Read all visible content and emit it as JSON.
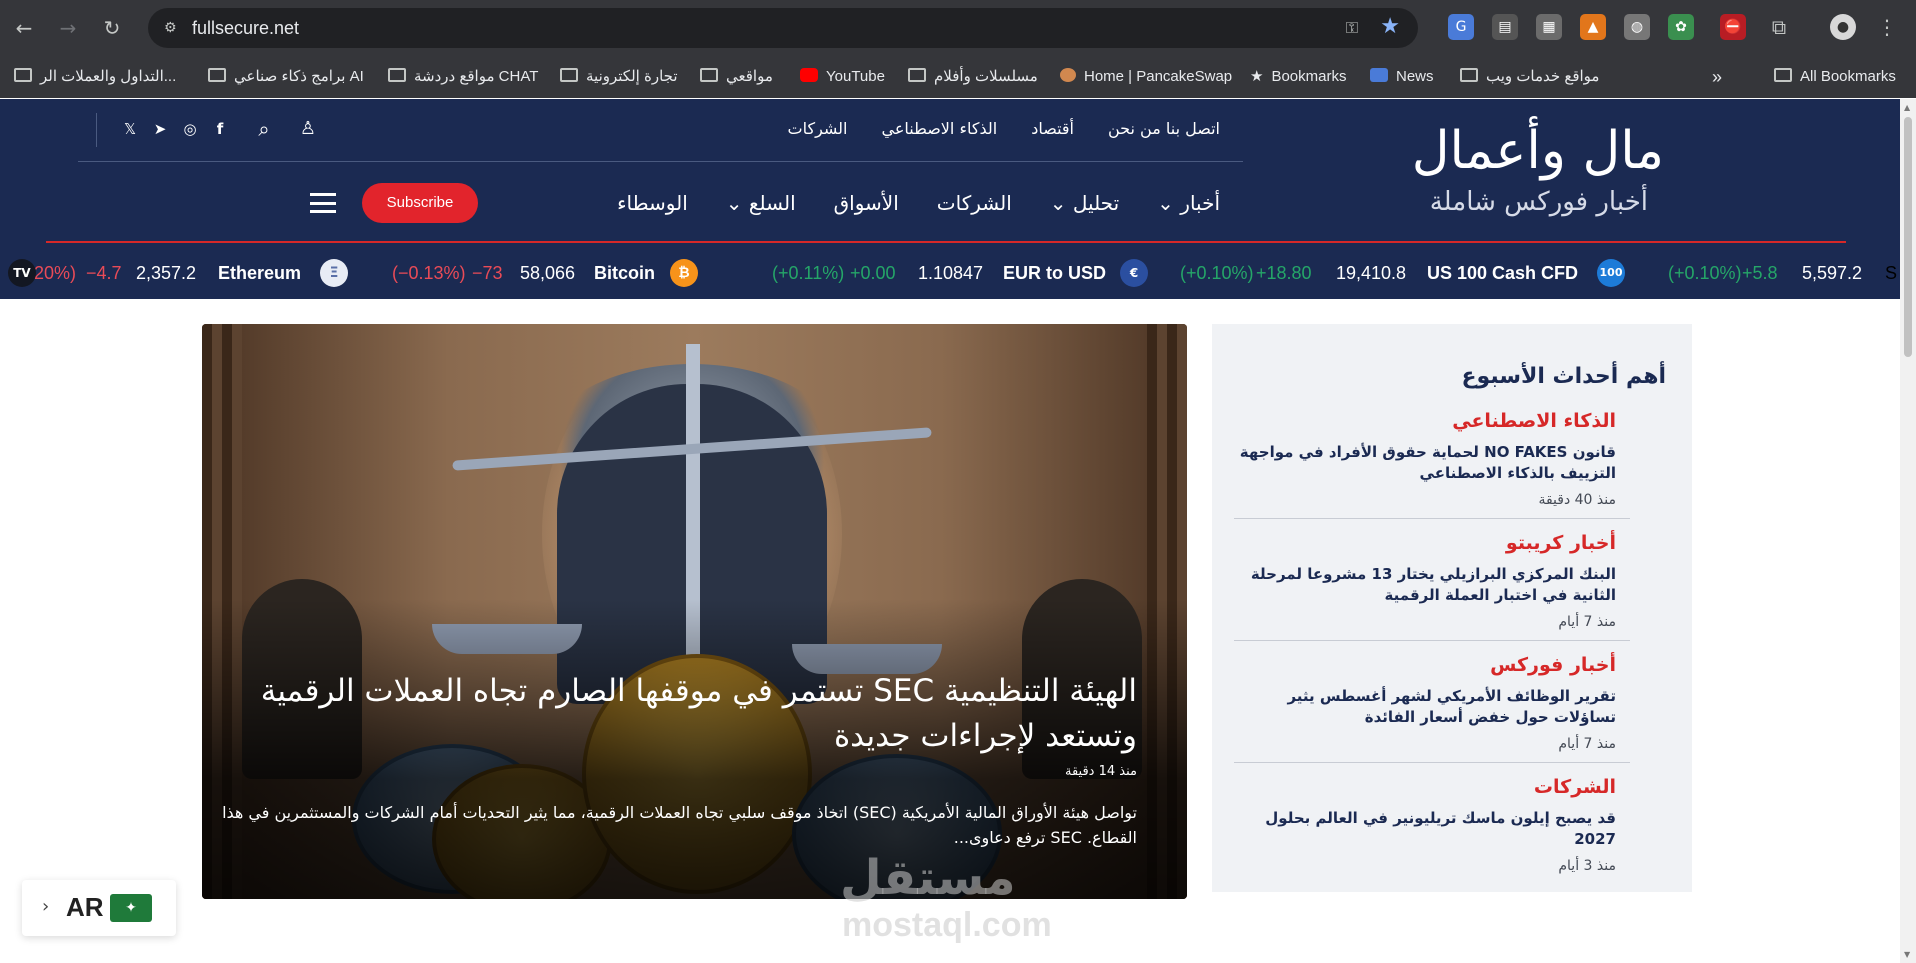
{
  "browser": {
    "url": "fullsecure.net",
    "bookmarks": [
      "التداول والعملات الر...",
      "برامج ذكاء صناعي AI",
      "مواقع دردشة CHAT",
      "تجارة إلكترونية",
      "مواقعي",
      "YouTube",
      "مسلسلات وأفلام",
      "Home | PancakeSwap",
      "Bookmarks",
      "News",
      "مواقع خدمات ويب",
      "All Bookmarks"
    ]
  },
  "site": {
    "logo_title": "مال وأعمال",
    "logo_subtitle": "أخبار فوركس شاملة",
    "top_links": [
      "الشركات",
      "الذكاء الاصطناعي",
      "أقتصاد",
      "اتصل بنا من نحن"
    ],
    "main_nav": [
      "الوسطاء",
      "السلع ⌄",
      "الأسواق",
      "الشركات",
      "تحليل ⌄",
      "أخبار ⌄"
    ],
    "subscribe_label": "Subscribe"
  },
  "ticker": [
    {
      "name": "S",
      "value": "5,597.2",
      "change": "+5.8",
      "pct": "(+0.10%)",
      "dir": "pos"
    },
    {
      "name": "US 100 Cash CFD",
      "value": "19,410.8",
      "change": "+18.80",
      "pct": "(+0.10%)",
      "dir": "pos",
      "icon": "100"
    },
    {
      "name": "EUR to USD",
      "value": "1.10847",
      "change": "+0.00",
      "pct": "(+0.11%)",
      "dir": "pos"
    },
    {
      "name": "Bitcoin",
      "value": "58,066",
      "change": "−73",
      "pct": "(−0.13%)",
      "dir": "neg",
      "icon": "₿"
    },
    {
      "name": "Ethereum",
      "value": "2,357.2",
      "change": "−4.7",
      "pct": "20%)",
      "dir": "neg",
      "icon": "Ξ"
    }
  ],
  "hero": {
    "title": "الهيئة التنظيمية SEC تستمر في موقفها الصارم تجاه العملات الرقمية وتستعد لإجراءات جديدة",
    "time": "منذ 14 دقيقة",
    "description": "تواصل هيئة الأوراق المالية الأمريكية (SEC) اتخاذ موقف سلبي تجاه العملات الرقمية، مما يثير التحديات أمام الشركات والمستثمرين في هذا القطاع. SEC ترفع دعاوى..."
  },
  "sidebar": {
    "title": "أهم أحداث الأسبوع",
    "items": [
      {
        "category": "الذكاء الاصطناعي",
        "headline": "قانون NO FAKES لحماية حقوق الأفراد في مواجهة التزييف بالذكاء الاصطناعي",
        "ago": "منذ 40 دقيقة"
      },
      {
        "category": "أخبار كريبتو",
        "headline": "البنك المركزي البرازيلي يختار 13 مشروعا لمرحلة الثانية في اختبار العملة الرقمية",
        "ago": "منذ 7 أيام"
      },
      {
        "category": "أخبار فوركس",
        "headline": "تقرير الوظائف الأمريكي لشهر أغسطس يثير تساؤلات حول خفض أسعار الفائدة",
        "ago": "منذ 7 أيام"
      },
      {
        "category": "الشركات",
        "headline": "قد يصبح إيلون ماسك تريليونير في العالم بحلول 2027",
        "ago": "منذ 3 أيام"
      }
    ]
  },
  "language": {
    "code": "AR"
  },
  "watermark": {
    "arabic": "مستقل",
    "latin": "mostaql.com"
  }
}
